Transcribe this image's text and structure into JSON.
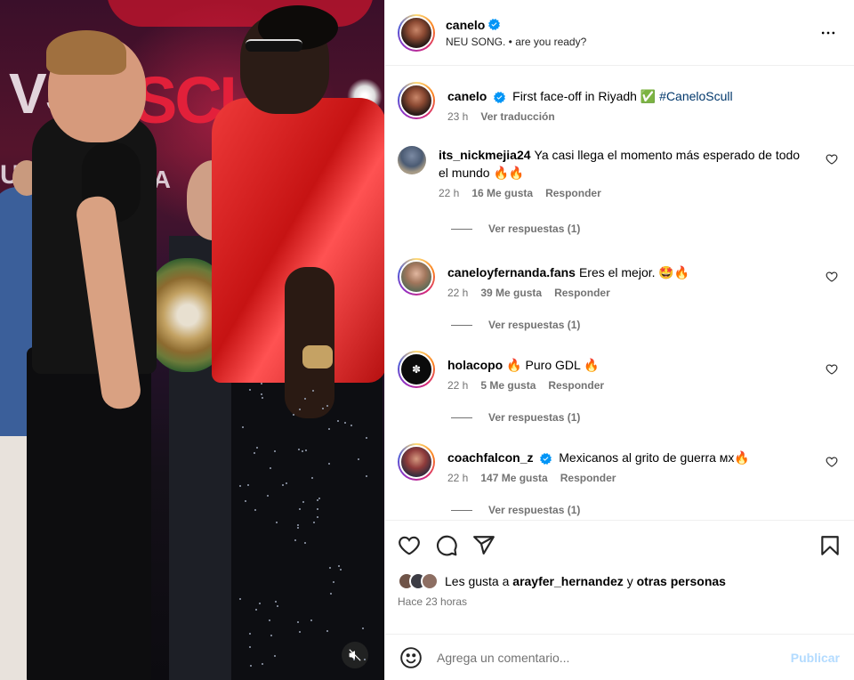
{
  "post_header": {
    "username": "canelo",
    "subtitle": "NEU SONG. • are you ready?",
    "more_icon": "more-horizontal-icon"
  },
  "caption": {
    "username": "canelo",
    "text": "First face-off in Riyadh",
    "emoji": "✅",
    "hashtag": "#CaneloScull",
    "time": "23 h",
    "translate": "Ver traducción"
  },
  "comments": [
    {
      "username": "its_nickmejia24",
      "verified": false,
      "text": "Ya casi llega el momento más esperado de todo el mundo 🔥🔥",
      "time": "22 h",
      "likes": "16 Me gusta",
      "reply": "Responder",
      "replies": "Ver respuestas (1)"
    },
    {
      "username": "caneloyfernanda.fans",
      "verified": false,
      "text": "Eres el mejor. 🤩🔥",
      "time": "22 h",
      "likes": "39 Me gusta",
      "reply": "Responder",
      "replies": "Ver respuestas (1)"
    },
    {
      "username": "holacopo",
      "verified": false,
      "text": "🔥 Puro GDL 🔥",
      "time": "22 h",
      "likes": "5 Me gusta",
      "reply": "Responder",
      "replies": "Ver respuestas (1)"
    },
    {
      "username": "coachfalcon_z",
      "verified": true,
      "text": "Mexicanos al grito de guerra ᴍx🔥",
      "time": "22 h",
      "likes": "147 Me gusta",
      "reply": "Responder",
      "replies": "Ver respuestas (1)"
    }
  ],
  "actions": {
    "like_icon": "heart-icon",
    "comment_icon": "comment-icon",
    "share_icon": "send-icon",
    "save_icon": "bookmark-icon",
    "likes_prefix": "Les gusta a",
    "likes_user": "arayfer_hernandez",
    "likes_connector": "y",
    "likes_others": "otras personas",
    "time_ago": "Hace 23 horas"
  },
  "add_comment": {
    "placeholder": "Agrega un comentario...",
    "post_label": "Publicar",
    "emoji_icon": "emoji-icon"
  },
  "media": {
    "mute_icon": "speaker-muted-icon"
  },
  "colors": {
    "verified_blue": "#0095f6",
    "muted_text": "#737373",
    "post_disabled": "#b3dbff",
    "hashtag": "#00376b"
  }
}
